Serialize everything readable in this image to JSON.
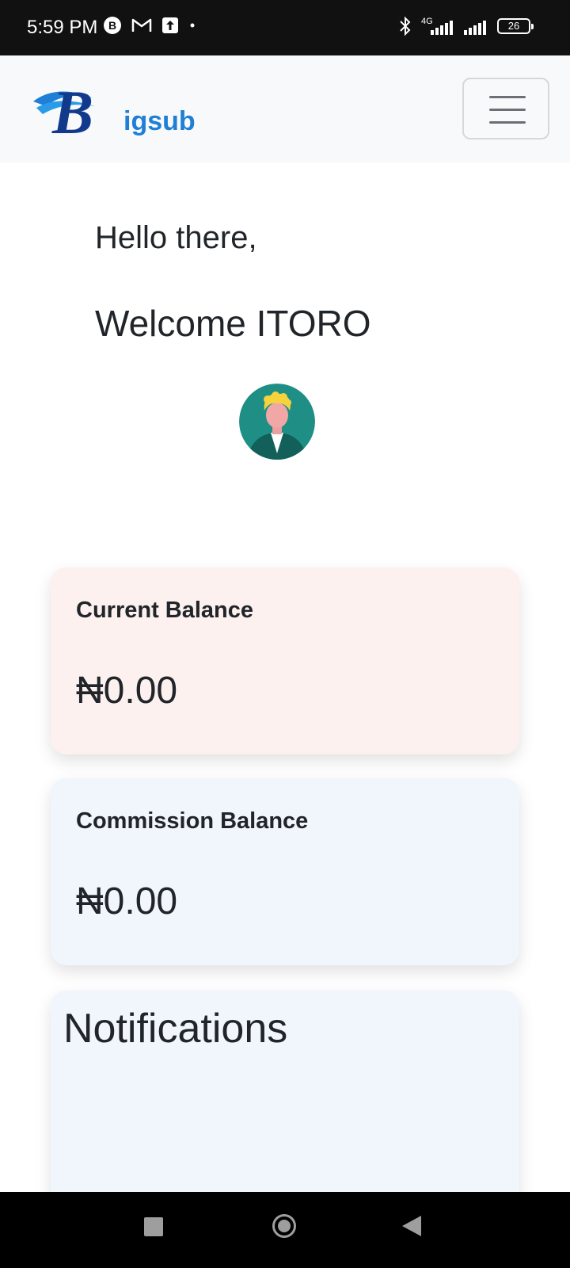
{
  "status_bar": {
    "time": "5:59 PM",
    "battery": "26",
    "network": "4G",
    "left_icons": [
      "b-circle-icon",
      "gmail-icon",
      "upload-icon",
      "dot-icon"
    ],
    "right_icons": [
      "bluetooth-icon",
      "signal-4g-icon",
      "signal-icon",
      "battery-icon"
    ]
  },
  "navbar": {
    "logo_text": "igsub",
    "logo_letter": "B",
    "menu_icon": "hamburger-icon"
  },
  "greeting": {
    "hello": "Hello there,",
    "welcome": "Welcome ITORO"
  },
  "balances": {
    "current": {
      "label": "Current Balance",
      "currency": "₦",
      "amount": "0.00"
    },
    "commission": {
      "label": "Commission Balance",
      "currency": "₦",
      "amount": "0.00"
    }
  },
  "notifications": {
    "title": "Notifications"
  },
  "colors": {
    "current_card": "#fcf1ef",
    "commission_card": "#f1f5fc",
    "logo_blue": "#1f7fd6",
    "logo_dark": "#123a8c"
  },
  "system_nav": [
    "recents-square-icon",
    "home-circle-icon",
    "back-triangle-icon"
  ]
}
